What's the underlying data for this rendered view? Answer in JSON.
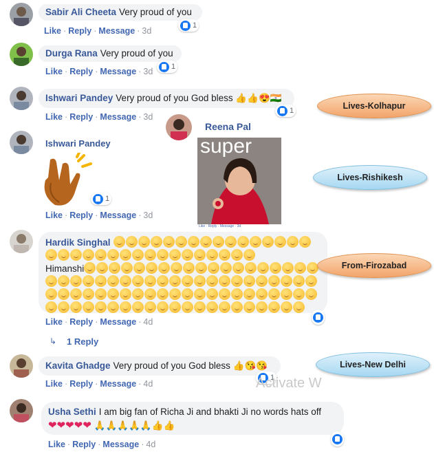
{
  "actions": {
    "like": "Like",
    "reply": "Reply",
    "message": "Message",
    "sep": "·"
  },
  "comments": [
    {
      "author": "Sabir Ali Cheeta",
      "text": "Very proud of you",
      "time": "3d",
      "reactions": "1"
    },
    {
      "author": "Durga Rana",
      "text": "Very proud of you",
      "time": "3d",
      "reactions": "1"
    },
    {
      "author": "Ishwari Pandey",
      "text": "Very proud of you God bless",
      "emoji": "👍👍😍🇮🇳",
      "time": "3d",
      "reactions": "1"
    },
    {
      "author": "Ishwari Pandey",
      "sticker": "👏",
      "time": "3d",
      "reactions": "1"
    },
    {
      "author": "Hardik Singhal",
      "text2": "Himanshi",
      "time": "4d"
    },
    {
      "author": "Kavita Ghadge",
      "text": "Very proud of you God bless",
      "emoji": "👍😘😘",
      "time": "4d",
      "reactions": "1"
    },
    {
      "author": "Usha Sethi",
      "text": "I am big fan of Richa Ji and bhakti Ji no words hats off",
      "time": "4d"
    }
  ],
  "replies_link": "1 Reply",
  "inset": {
    "author": "Reena Pal",
    "caption": "super",
    "mini_actions": "Like · Reply · Message · 3d"
  },
  "labels": {
    "kolhapur": "Lives-Kolhapur",
    "rishikesh": "Lives-Rishikesh",
    "firozabad": "From-Firozabad",
    "delhi": "Lives-New Delhi"
  },
  "watermark": "Activate W",
  "colors": {
    "link": "#385898",
    "actions": "#4267b2",
    "bubble": "#f2f3f5"
  }
}
